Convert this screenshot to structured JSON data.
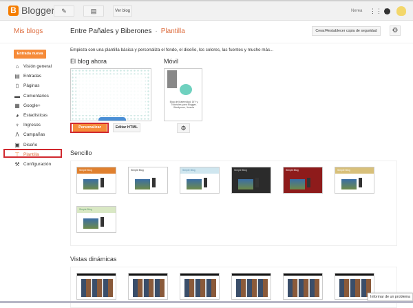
{
  "header": {
    "brand": "Blogger",
    "view_blog": "Ver blog",
    "user": "Nerea",
    "logo_letter": "B"
  },
  "subheader": {
    "my_blogs": "Mis blogs",
    "blog_name": "Entre Pañales y Biberones",
    "separator": "·",
    "section": "Plantilla",
    "backup_button": "Crear/Restablecer copia de seguridad"
  },
  "sidebar": {
    "new_post": "Entrada nueva",
    "items": [
      {
        "label": "Visión general",
        "icon": "home-icon"
      },
      {
        "label": "Entradas",
        "icon": "posts-icon"
      },
      {
        "label": "Páginas",
        "icon": "pages-icon"
      },
      {
        "label": "Comentarios",
        "icon": "comments-icon"
      },
      {
        "label": "Google+",
        "icon": "google-plus-icon"
      },
      {
        "label": "Estadísticas",
        "icon": "stats-icon"
      },
      {
        "label": "Ingresos",
        "icon": "earnings-icon"
      },
      {
        "label": "Campañas",
        "icon": "campaigns-icon"
      },
      {
        "label": "Diseño",
        "icon": "layout-icon"
      },
      {
        "label": "Plantilla",
        "icon": "template-icon",
        "active": true
      },
      {
        "label": "Configuración",
        "icon": "wrench-icon"
      }
    ]
  },
  "main": {
    "intro": "Empieza con una plantilla básica y personaliza el fondo, el diseño, los colores, las fuentes y mucho más...",
    "current_blog": "El blog ahora",
    "mobile": "Móvil",
    "mobile_preview_text": "Blog de Maternidad, DIY y Tutoriales para Blogger, Wordpress, Joomla",
    "customize": "Personalizar",
    "edit_html": "Editar HTML",
    "simple_title": "Sencillo",
    "simple_thumb_title": "Simple Blog",
    "dynamic_title": "Vistas dinámicas",
    "simple_colors": [
      "#e0802e",
      "#ffffff",
      "#cfe6ef",
      "#2b2b2b",
      "#8e1b1b",
      "#d8c07a",
      "#d9e8c4"
    ],
    "simple_header_text": [
      "#ffffff",
      "#333333",
      "#5b8fb0",
      "#dddddd",
      "#ffffff",
      "#ffffff",
      "#5a9a6a"
    ]
  },
  "report": "Informar de un problema"
}
